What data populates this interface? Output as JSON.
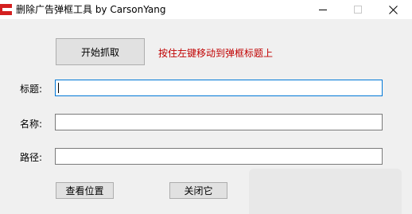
{
  "window": {
    "title": "删除广告弹框工具 by CarsonYang",
    "controls": {
      "minimize_icon": "minimize-icon",
      "maximize_icon": "maximize-icon",
      "close_icon": "close-icon"
    }
  },
  "toolbar": {
    "start_label": "开始抓取",
    "hint_text": "按住左键移动到弹框标题上"
  },
  "form": {
    "title_label": "标题:",
    "title_value": "",
    "name_label": "名称:",
    "name_value": "",
    "path_label": "路径:",
    "path_value": ""
  },
  "actions": {
    "locate_label": "查看位置",
    "close_label": "关闭它"
  },
  "colors": {
    "accent": "#0078d7",
    "hint": "#c00000",
    "app_icon": "#d42020"
  }
}
